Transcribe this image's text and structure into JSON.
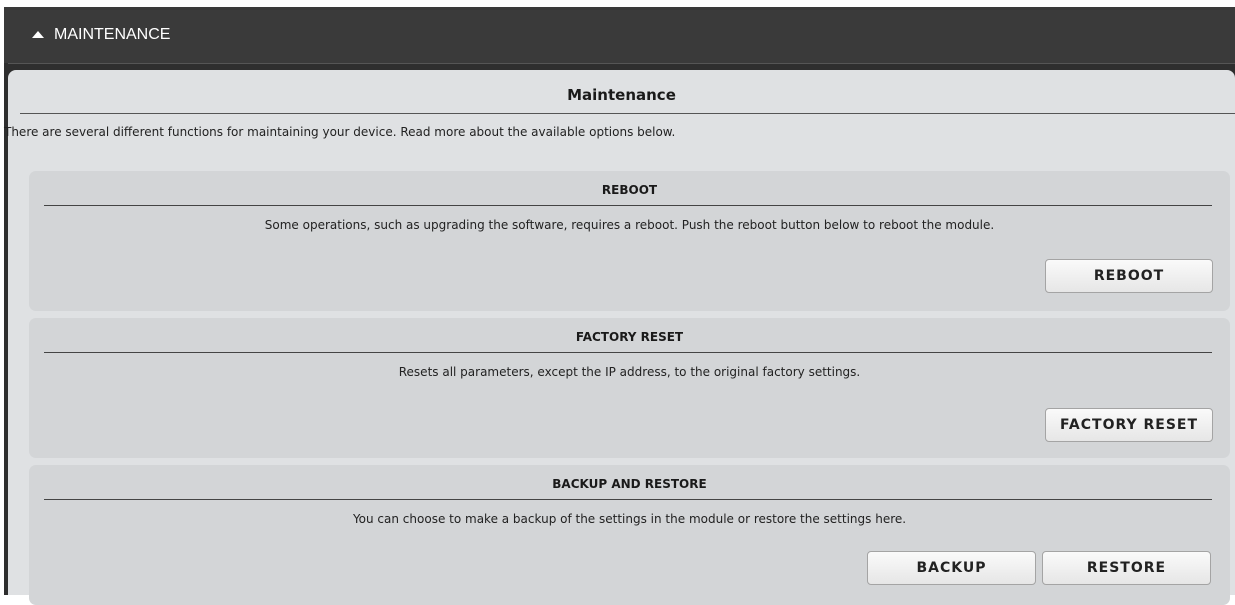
{
  "header": {
    "title": "MAINTENANCE",
    "icon": "caret-up-icon"
  },
  "main": {
    "title": "Maintenance",
    "intro": "There are several different functions for maintaining your device. Read more about the available options below."
  },
  "panels": [
    {
      "title": "REBOOT",
      "description": "Some operations, such as upgrading the software, requires a reboot. Push the reboot button below to reboot the module.",
      "buttons": [
        "REBOOT"
      ]
    },
    {
      "title": "FACTORY RESET",
      "description": "Resets all parameters, except the IP address, to the original factory settings.",
      "buttons": [
        "FACTORY RESET"
      ]
    },
    {
      "title": "BACKUP AND RESTORE",
      "description": "You can choose to make a backup of the settings in the module or restore the settings here.",
      "buttons": [
        "BACKUP",
        "RESTORE"
      ]
    }
  ],
  "colors": {
    "header_bg": "#3a3a3a",
    "content_bg": "#dfe1e3",
    "panel_bg": "#d3d5d7"
  }
}
